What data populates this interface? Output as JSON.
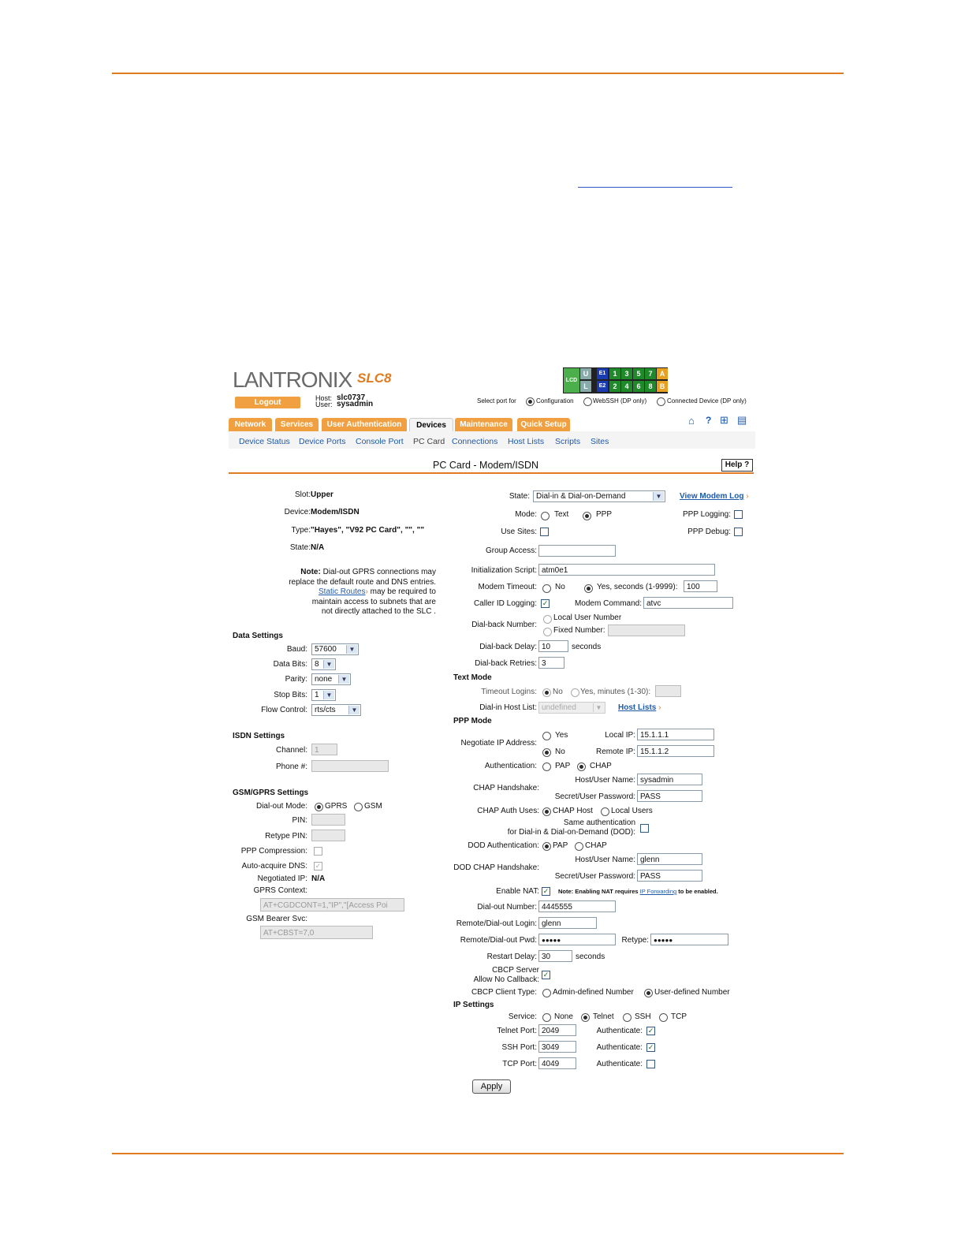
{
  "brand": {
    "logo": "LANTRONIX",
    "product": "SLC8"
  },
  "header": {
    "logout_label": "Logout",
    "host_label": "Host:",
    "host_value": "slc0737",
    "user_label": "User:",
    "user_value": "sysadmin",
    "select_port_label": "Select port for",
    "port_options": [
      "Configuration",
      "WebSSH (DP only)",
      "Connected Device (DP only)"
    ],
    "selected_port_option": "Configuration"
  },
  "status_panel": {
    "lcd": "LCD",
    "u": "U",
    "l": "L",
    "e1": "E1",
    "e2": "E2",
    "odd": [
      "1",
      "3",
      "5",
      "7"
    ],
    "even": [
      "2",
      "4",
      "6",
      "8"
    ],
    "a": "A",
    "b": "B"
  },
  "tabs": [
    "Network",
    "Services",
    "User Authentication",
    "Devices",
    "Maintenance",
    "Quick Setup"
  ],
  "active_tab": "Devices",
  "toolbar_icons": [
    "home-icon",
    "help-icon",
    "site-map-icon",
    "log-icon"
  ],
  "subnav": [
    "Device Status",
    "Device Ports",
    "Console Port",
    "PC Card",
    "Connections",
    "Host Lists",
    "Scripts",
    "Sites"
  ],
  "active_subnav": "PC Card",
  "page": {
    "title": "PC Card - Modem/ISDN",
    "help_label": "Help ?"
  },
  "left": {
    "slot_label": "Slot:",
    "slot_value": "Upper",
    "device_label": "Device:",
    "device_value": "Modem/ISDN",
    "type_label": "Type:",
    "type_value": "\"Hayes\", \"V92 PC Card\", \"\", \"\"",
    "state_label": "State:",
    "state_value": "N/A",
    "note_bold": "Note:",
    "note_line1": "Dial-out GPRS connections may",
    "note_line2": "replace the default route and DNS entries.",
    "note_link": "Static Routes",
    "note_line3": "may be required to",
    "note_line4": "maintain access to subnets that are",
    "note_line5": "not directly attached to the SLC .",
    "data_settings": "Data Settings",
    "baud_label": "Baud:",
    "baud_value": "57600",
    "data_bits_label": "Data Bits:",
    "data_bits_value": "8",
    "parity_label": "Parity:",
    "parity_value": "none",
    "stop_bits_label": "Stop Bits:",
    "stop_bits_value": "1",
    "flow_label": "Flow Control:",
    "flow_value": "rts/cts",
    "isdn_settings": "ISDN Settings",
    "channel_label": "Channel:",
    "channel_value": "1",
    "phone_label": "Phone #:",
    "phone_value": "",
    "gsm_settings": "GSM/GPRS Settings",
    "dialout_mode_label": "Dial-out Mode:",
    "dialout_modes": [
      "GPRS",
      "GSM"
    ],
    "pin_label": "PIN:",
    "retype_pin_label": "Retype PIN:",
    "ppp_compression_label": "PPP Compression:",
    "auto_dns_label": "Auto-acquire DNS:",
    "negotiated_ip_label": "Negotiated IP:",
    "negotiated_ip_value": "N/A",
    "gprs_context_label": "GPRS Context:",
    "gprs_context_value": "AT+CGDCONT=1,\"IP\",\"[Access Poi",
    "gsm_bearer_label": "GSM Bearer Svc:",
    "gsm_bearer_value": "AT+CBST=7,0"
  },
  "right": {
    "state_label": "State:",
    "state_value": "Dial-in & Dial-on-Demand",
    "view_log": "View Modem Log",
    "mode_label": "Mode:",
    "mode_text": "Text",
    "mode_ppp": "PPP",
    "ppp_logging_label": "PPP Logging:",
    "ppp_debug_label": "PPP Debug:",
    "use_sites_label": "Use Sites:",
    "group_access_label": "Group Access:",
    "group_access_value": "",
    "init_script_label": "Initialization Script:",
    "init_script_value": "atm0e1",
    "modem_timeout_label": "Modem Timeout:",
    "timeout_no": "No",
    "timeout_yes": "Yes, seconds (1-9999):",
    "timeout_value": "100",
    "caller_id_label": "Caller ID Logging:",
    "modem_command_label": "Modem Command:",
    "modem_command_value": "atvc",
    "dialback_label": "Dial-back Number:",
    "local_user_number": "Local User Number",
    "fixed_number": "Fixed Number:",
    "dialback_delay_label": "Dial-back Delay:",
    "dialback_delay_value": "10",
    "seconds": "seconds",
    "dialback_retries_label": "Dial-back Retries:",
    "dialback_retries_value": "3",
    "text_mode": "Text Mode",
    "timeout_logins_label": "Timeout Logins:",
    "tl_no": "No",
    "tl_yes": "Yes, minutes (1-30):",
    "dialin_host_list_label": "Dial-in Host List:",
    "dialin_host_list_value": "undefined",
    "host_lists_link": "Host Lists",
    "ppp_mode": "PPP Mode",
    "negotiate_ip_label": "Negotiate IP Address:",
    "neg_yes": "Yes",
    "neg_no": "No",
    "local_ip_label": "Local IP:",
    "local_ip_value": "15.1.1.1",
    "remote_ip_label": "Remote IP:",
    "remote_ip_value": "15.1.1.2",
    "authentication_label": "Authentication:",
    "auth_pap": "PAP",
    "auth_chap": "CHAP",
    "chap_handshake_label": "CHAP Handshake:",
    "host_user_name_label": "Host/User Name:",
    "chap_host_value": "sysadmin",
    "secret_label": "Secret/User Password:",
    "chap_secret_value": "PASS",
    "chap_auth_uses_label": "CHAP Auth Uses:",
    "chap_host_opt": "CHAP Host",
    "local_users_opt": "Local Users",
    "same_auth_line1": "Same authentication",
    "same_auth_line2": "for Dial-in & Dial-on-Demand (DOD):",
    "dod_auth_label": "DOD Authentication:",
    "dod_pap": "PAP",
    "dod_chap": "CHAP",
    "dod_chap_label": "DOD CHAP Handshake:",
    "dod_host_value": "glenn",
    "dod_secret_value": "PASS",
    "enable_nat_label": "Enable NAT:",
    "nat_note_bold": "Note: Enabling NAT requires",
    "nat_note_link": "IP Forwarding",
    "nat_note_end": "to be enabled.",
    "dialout_number_label": "Dial-out Number:",
    "dialout_number_value": "4445555",
    "remote_login_label": "Remote/Dial-out Login:",
    "remote_login_value": "glenn",
    "remote_pwd_label": "Remote/Dial-out Pwd:",
    "remote_pwd_value": "●●●●●",
    "retype_label": "Retype:",
    "retype_value": "●●●●●",
    "restart_delay_label": "Restart Delay:",
    "restart_delay_value": "30",
    "cbcp_server_line1": "CBCP Server",
    "cbcp_server_line2": "Allow No Callback:",
    "cbcp_client_label": "CBCP Client Type:",
    "cbcp_admin": "Admin-defined Number",
    "cbcp_user": "User-defined Number",
    "ip_settings": "IP Settings",
    "service_label": "Service:",
    "service_options": [
      "None",
      "Telnet",
      "SSH",
      "TCP"
    ],
    "telnet_port_label": "Telnet Port:",
    "telnet_port_value": "2049",
    "ssh_port_label": "SSH Port:",
    "ssh_port_value": "3049",
    "tcp_port_label": "TCP Port:",
    "tcp_port_value": "4049",
    "authenticate_label": "Authenticate:",
    "apply_label": "Apply"
  },
  "colors": {
    "accent": "#e07b20",
    "tab": "#f0a040",
    "link": "#1f5aa8"
  }
}
